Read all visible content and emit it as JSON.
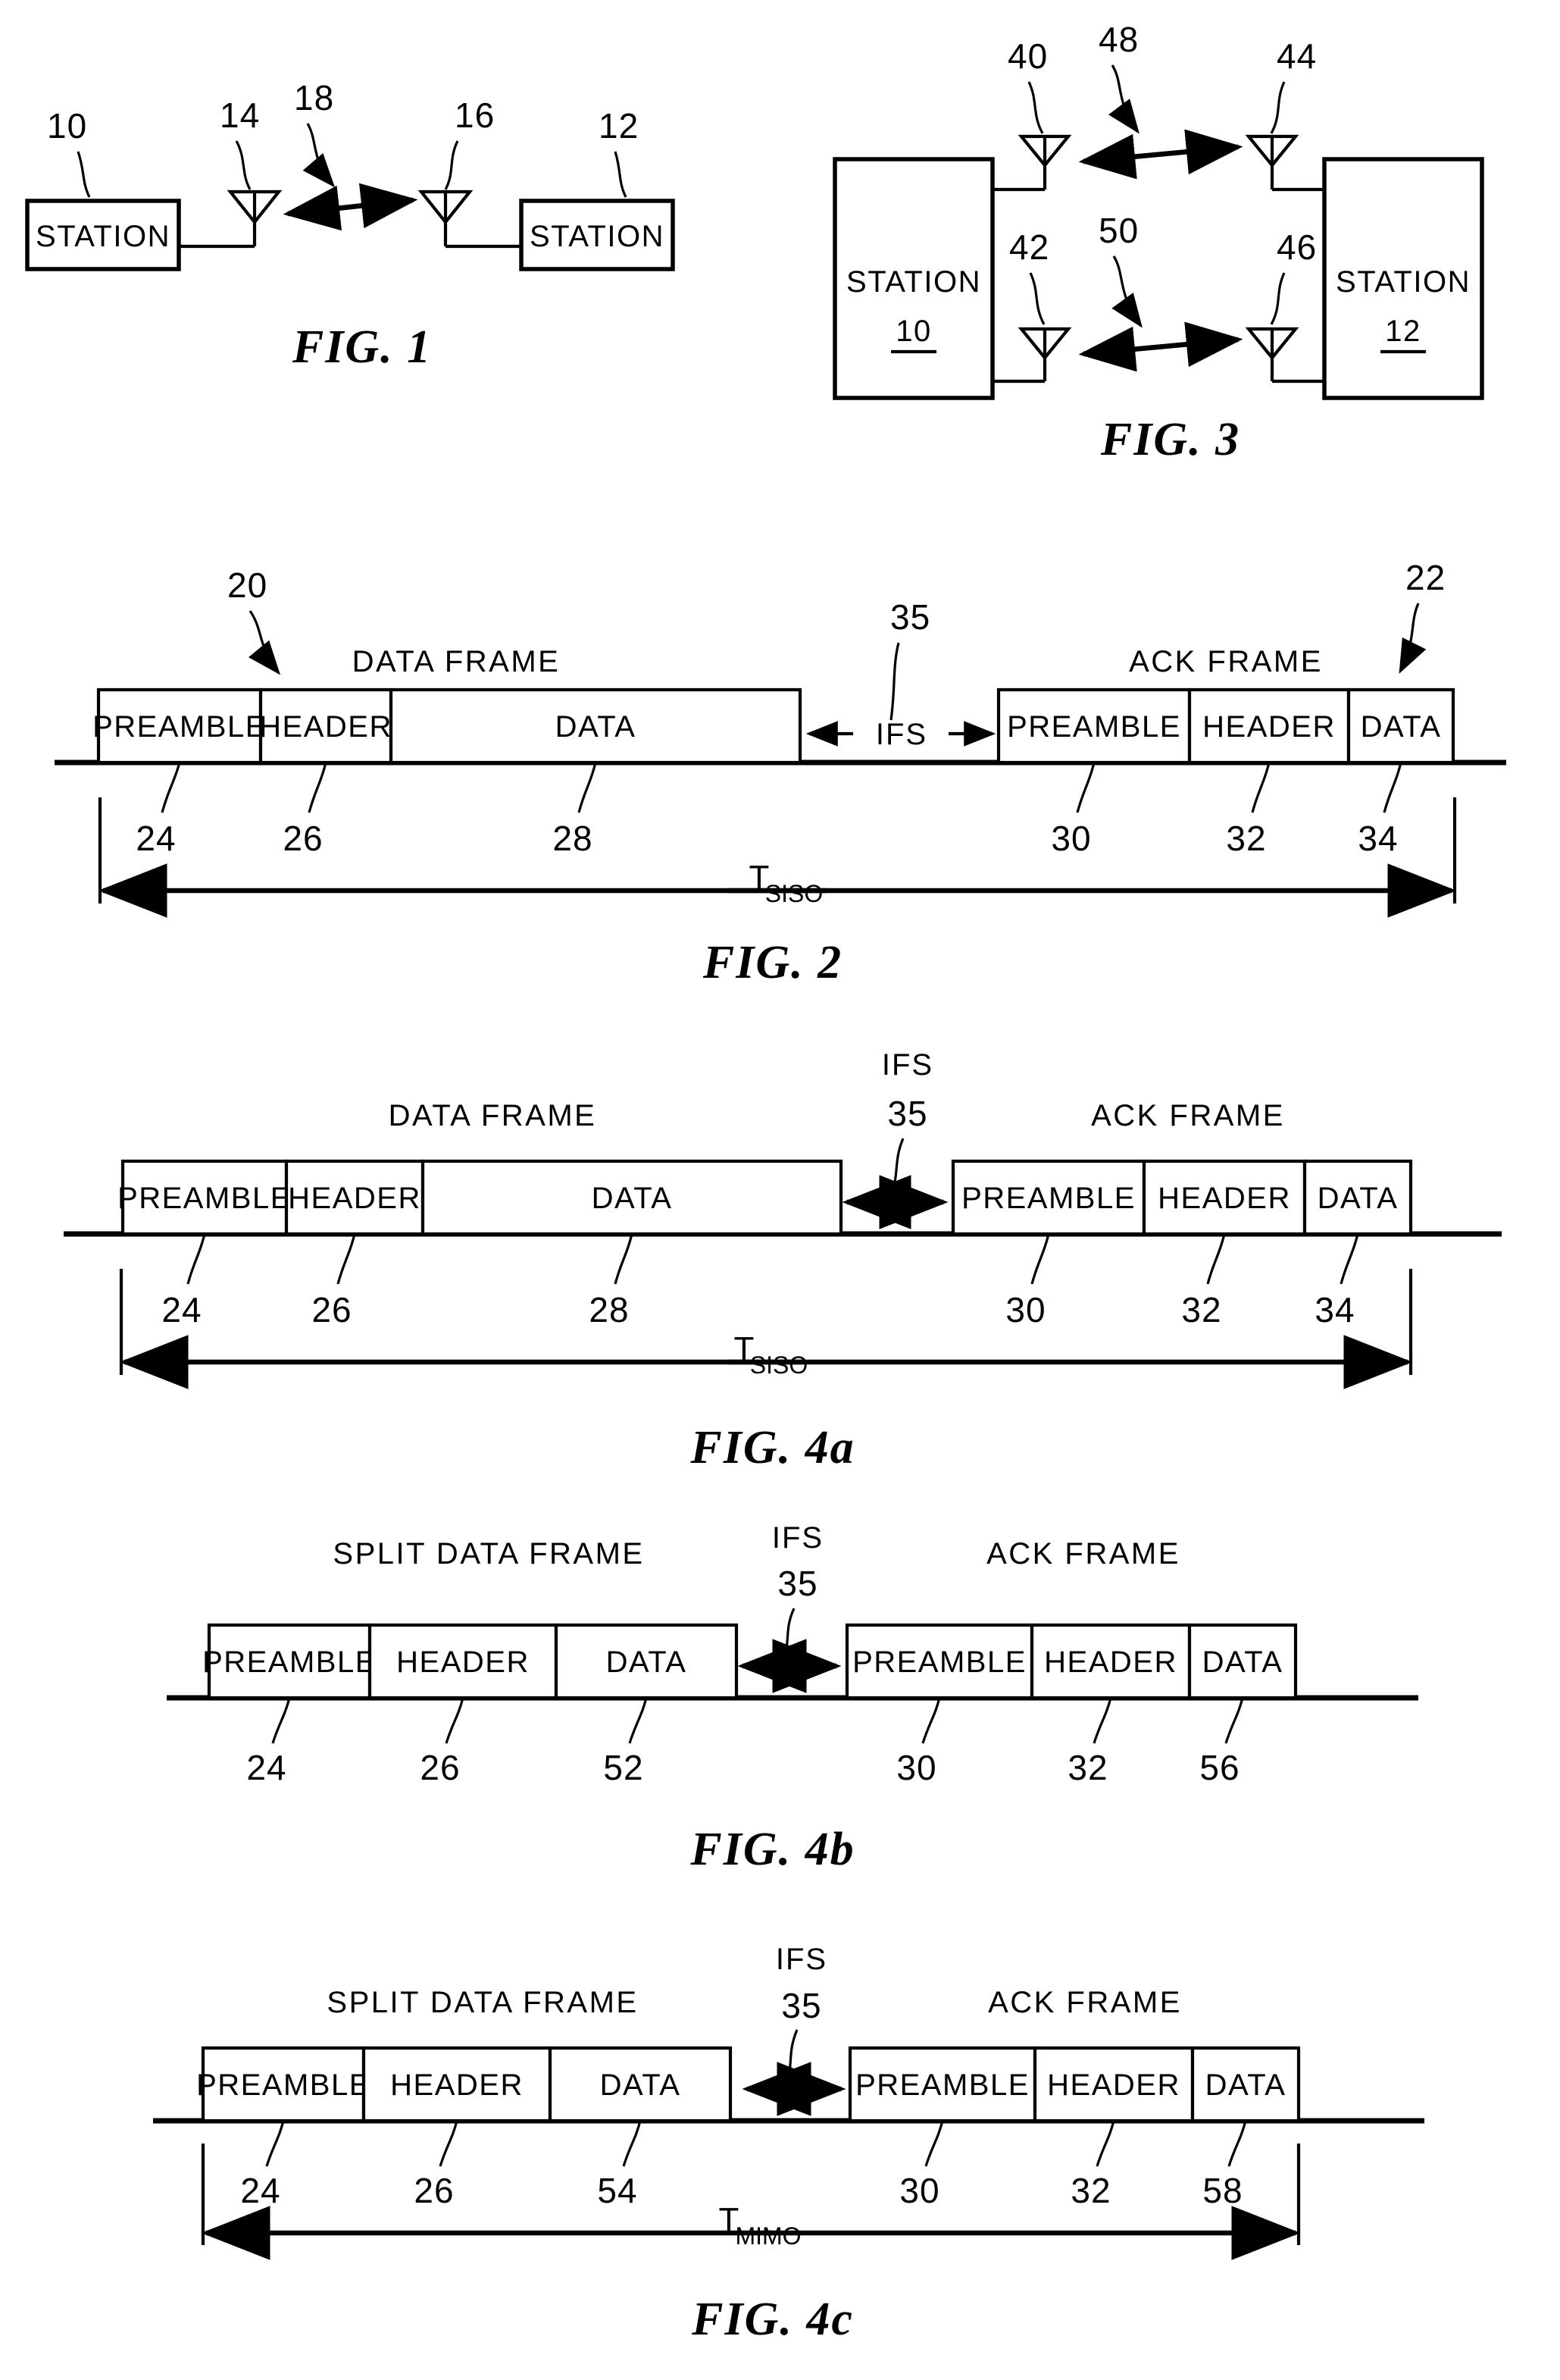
{
  "document": {
    "kind": "patent-drawing-sheet",
    "background_color": "#ffffff",
    "ink_color": "#000000"
  },
  "figures": [
    {
      "id": "fig1",
      "caption": "FIG.  1",
      "type": "siso-link-diagram",
      "station_left": {
        "label": "STATION",
        "ref": "10"
      },
      "station_right": {
        "label": "STATION",
        "ref": "12"
      },
      "antenna_left_ref": "14",
      "antenna_right_ref": "16",
      "link_ref": "18"
    },
    {
      "id": "fig3",
      "caption": "FIG.  3",
      "type": "mimo-link-diagram",
      "station_left": {
        "label": "STATION",
        "ref": "10"
      },
      "station_right": {
        "label": "STATION",
        "ref": "12"
      },
      "antennas": [
        {
          "ref": "40",
          "side": "left",
          "row": "top"
        },
        {
          "ref": "42",
          "side": "left",
          "row": "bottom"
        },
        {
          "ref": "44",
          "side": "right",
          "row": "top"
        },
        {
          "ref": "46",
          "side": "right",
          "row": "bottom"
        }
      ],
      "links": [
        {
          "ref": "48",
          "row": "top"
        },
        {
          "ref": "50",
          "row": "bottom"
        }
      ]
    },
    {
      "id": "fig2",
      "caption": "FIG.  2",
      "type": "frame-timing-diagram",
      "data_frame": {
        "title": "DATA FRAME",
        "ref": "20",
        "cells": [
          {
            "text": "PREAMBLE",
            "ref": "24"
          },
          {
            "text": "HEADER",
            "ref": "26"
          },
          {
            "text": "DATA",
            "ref": "28"
          }
        ]
      },
      "gap": {
        "label": "IFS",
        "ref": "35",
        "style": "inline-arrows"
      },
      "ack_frame": {
        "title": "ACK FRAME",
        "ref": "22",
        "cells": [
          {
            "text": "PREAMBLE",
            "ref": "30"
          },
          {
            "text": "HEADER",
            "ref": "32"
          },
          {
            "text": "DATA",
            "ref": "34"
          }
        ]
      },
      "duration": {
        "symbol": "T",
        "subscript": "SISO"
      }
    },
    {
      "id": "fig4a",
      "caption": "FIG.  4a",
      "type": "frame-timing-diagram",
      "data_frame": {
        "title": "DATA FRAME",
        "cells": [
          {
            "text": "PREAMBLE",
            "ref": "24"
          },
          {
            "text": "HEADER",
            "ref": "26"
          },
          {
            "text": "DATA",
            "ref": "28"
          }
        ]
      },
      "gap": {
        "label": "IFS",
        "ref": "35",
        "style": "stacked-above"
      },
      "ack_frame": {
        "title": "ACK FRAME",
        "cells": [
          {
            "text": "PREAMBLE",
            "ref": "30"
          },
          {
            "text": "HEADER",
            "ref": "32"
          },
          {
            "text": "DATA",
            "ref": "34"
          }
        ]
      },
      "duration": {
        "symbol": "T",
        "subscript": "SISO"
      }
    },
    {
      "id": "fig4b",
      "caption": "FIG.  4b",
      "type": "frame-timing-diagram",
      "data_frame": {
        "title": "SPLIT DATA FRAME",
        "cells": [
          {
            "text": "PREAMBLE",
            "ref": "24"
          },
          {
            "text": "HEADER",
            "ref": "26"
          },
          {
            "text": "DATA",
            "ref": "52"
          }
        ]
      },
      "gap": {
        "label": "IFS",
        "ref": "35",
        "style": "stacked-above"
      },
      "ack_frame": {
        "title": "ACK FRAME",
        "cells": [
          {
            "text": "PREAMBLE",
            "ref": "30"
          },
          {
            "text": "HEADER",
            "ref": "32"
          },
          {
            "text": "DATA",
            "ref": "56"
          }
        ]
      },
      "duration": null
    },
    {
      "id": "fig4c",
      "caption": "FIG.  4c",
      "type": "frame-timing-diagram",
      "data_frame": {
        "title": "SPLIT DATA FRAME",
        "cells": [
          {
            "text": "PREAMBLE",
            "ref": "24"
          },
          {
            "text": "HEADER",
            "ref": "26"
          },
          {
            "text": "DATA",
            "ref": "54"
          }
        ]
      },
      "gap": {
        "label": "IFS",
        "ref": "35",
        "style": "stacked-above"
      },
      "ack_frame": {
        "title": "ACK FRAME",
        "cells": [
          {
            "text": "PREAMBLE",
            "ref": "30"
          },
          {
            "text": "HEADER",
            "ref": "32"
          },
          {
            "text": "DATA",
            "ref": "58"
          }
        ]
      },
      "duration": {
        "symbol": "T",
        "subscript": "MIMO"
      }
    }
  ]
}
